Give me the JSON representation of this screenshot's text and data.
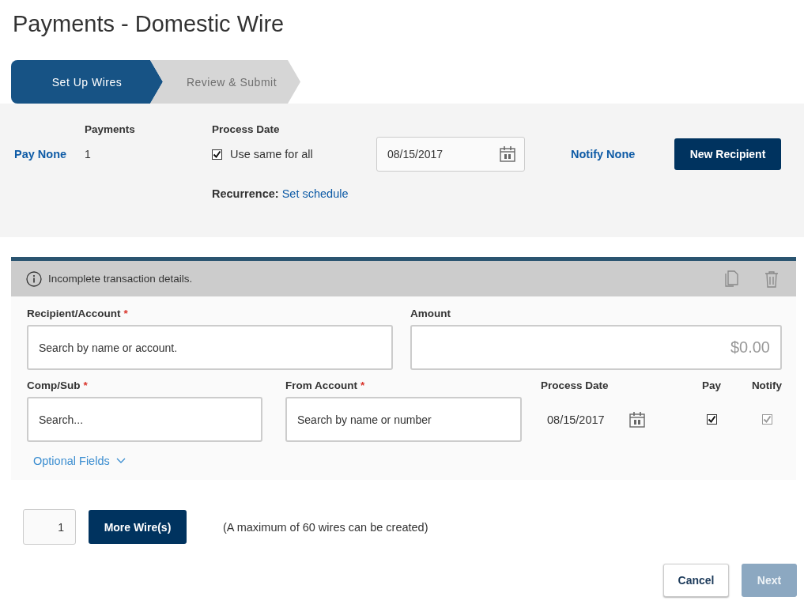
{
  "title": "Payments - Domestic Wire",
  "steps": [
    {
      "label": "Set Up Wires",
      "selected": true
    },
    {
      "label": "Review & Submit",
      "selected": false
    }
  ],
  "summary": {
    "pay_link": "Pay None",
    "payments": {
      "label": "Payments",
      "value": "1"
    },
    "process_date": {
      "label": "Process Date",
      "use_same": {
        "label": "Use same for all",
        "checked": true
      },
      "value": "08/15/2017"
    },
    "notify_link": "Notify None",
    "new_recipient_button": "New Recipient",
    "recurrence": {
      "label": "Recurrence:",
      "link": "Set schedule"
    }
  },
  "wire": {
    "status": "Incomplete transaction details.",
    "recipient": {
      "label": "Recipient/Account",
      "required_mark": "*",
      "placeholder": "Search by name or account."
    },
    "amount": {
      "label": "Amount",
      "placeholder": "$0.00"
    },
    "comp_sub": {
      "label": "Comp/Sub",
      "required_mark": "*",
      "placeholder": "Search..."
    },
    "from_account": {
      "label": "From Account",
      "required_mark": "*",
      "placeholder": "Search by name or number"
    },
    "process_date": {
      "label": "Process Date",
      "value": "08/15/2017"
    },
    "pay": {
      "label": "Pay",
      "checked": true,
      "disabled": false
    },
    "notify": {
      "label": "Notify",
      "checked": true,
      "disabled": true
    },
    "optional_fields_link": "Optional Fields"
  },
  "footer": {
    "count": "1",
    "more_button": "More Wire(s)",
    "note": "(A maximum of 60 wires can be created)",
    "cancel_button": "Cancel",
    "next_button": {
      "label": "Next",
      "disabled": true
    }
  }
}
